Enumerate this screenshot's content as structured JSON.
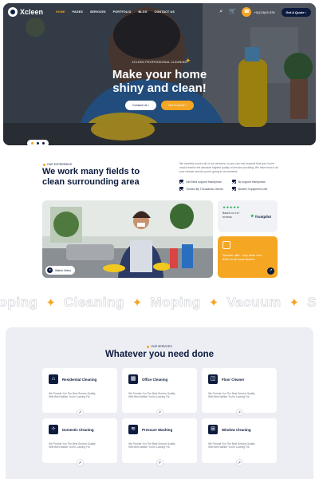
{
  "nav": {
    "logo": "Xcleen",
    "menu": [
      "HOME",
      "PAGES",
      "SERVICES",
      "PORTFOLIO",
      "BLOG",
      "CONTACT US"
    ],
    "phone": "+0(123)45 578",
    "quote_button": "Get A Quote"
  },
  "hero": {
    "kicker": "XCLEEN PROFESSIONAL CLEANING",
    "title_line1": "Make your home",
    "title_line2": "shiny and clean!",
    "button_primary": "Contact Us",
    "button_secondary": "Get A Quote"
  },
  "about": {
    "tag": "OUR EXPERIENCE",
    "title": "We work many fields to clean surrounding area",
    "text": "We carefully screen all of our cleaners, so you can rest assured that your home would receive the absolute highest quality of service providing. We have trust in all your cleaner service you're going to recommend.",
    "checks": [
      "Get Medi support Handyman",
      "5k support Handyman",
      "Trusted By Thousands Clients",
      "Modern Equipment Use"
    ],
    "watch_label": "Watch Video",
    "trust": {
      "stars": "★★★★★",
      "text": "Based on 1k+ reviews",
      "brand": "Trustpilot"
    },
    "promo": "Summer offer – Any clean over $100 on all hours service."
  },
  "marquee": [
    "Moping",
    "Cleaning",
    "Moping",
    "Vacuum",
    "S"
  ],
  "services": {
    "tag": "OUR SERVICES",
    "title": "Whatever you need done",
    "cards": [
      {
        "title": "Residential Cleaning",
        "icon": "home-icon",
        "text": "We Provide You The Best Service Quality With Best Walker You're Looking For."
      },
      {
        "title": "Office Cleaning",
        "icon": "office-icon",
        "text": "We Provide You The Best Service Quality With Best Walker You're Looking For."
      },
      {
        "title": "Floor Cleaner",
        "icon": "floor-icon",
        "text": "We Provide You The Best Service Quality With Best Walker You're Looking For."
      },
      {
        "title": "Domestic Cleaning",
        "icon": "domestic-icon",
        "text": "We Provide You The Best Service Quality With Best Walker You're Looking For."
      },
      {
        "title": "Pressure Washing",
        "icon": "washing-icon",
        "text": "We Provide You The Best Service Quality With Best Walker You're Looking For."
      },
      {
        "title": "Window Cleaning",
        "icon": "window-icon",
        "text": "We Provide You The Best Service Quality With Best Walker You're Looking For."
      }
    ]
  },
  "colors": {
    "navy": "#0d1b3e",
    "accent": "#f5a623",
    "panel": "#edeef3"
  }
}
